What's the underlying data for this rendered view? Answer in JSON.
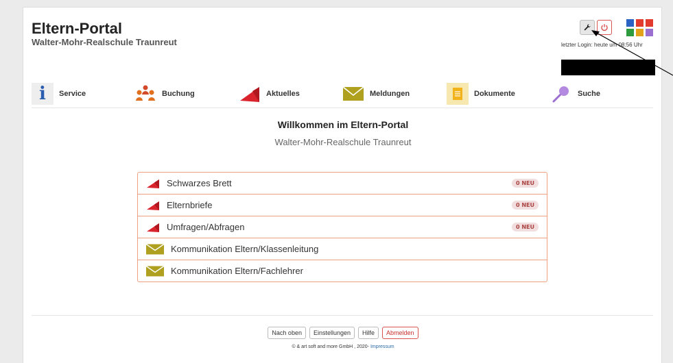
{
  "header": {
    "title": "Eltern-Portal",
    "subtitle": "Walter-Mohr-Realschule Traunreut",
    "last_login": "letzter Login: heute um 08:56 Uhr"
  },
  "toolbar": {
    "settings_icon": "wrench-icon",
    "logout_icon": "power-icon",
    "apps_icon": "tile-grid-icon",
    "tile_colors": [
      "#2a63c4",
      "#e23a2e",
      "#e23a2e",
      "#2e9c3e",
      "#e2a21a",
      "#9b6fcf"
    ]
  },
  "nav": [
    {
      "label": "Service",
      "icon": "info-icon"
    },
    {
      "label": "Buchung",
      "icon": "people-icon"
    },
    {
      "label": "Aktuelles",
      "icon": "megaphone-icon"
    },
    {
      "label": "Meldungen",
      "icon": "envelope-icon"
    },
    {
      "label": "Dokumente",
      "icon": "document-icon"
    },
    {
      "label": "Suche",
      "icon": "magnifier-icon"
    }
  ],
  "welcome": {
    "title": "Willkommen im Eltern-Portal",
    "subtitle": "Walter-Mohr-Realschule Traunreut"
  },
  "list": [
    {
      "label": "Schwarzes Brett",
      "icon": "megaphone-icon",
      "badge": "0 NEU"
    },
    {
      "label": "Elternbriefe",
      "icon": "megaphone-icon",
      "badge": "0 NEU"
    },
    {
      "label": "Umfragen/Abfragen",
      "icon": "megaphone-icon",
      "badge": "0 NEU"
    },
    {
      "label": "Kommunikation Eltern/Klassenleitung",
      "icon": "envelope-icon"
    },
    {
      "label": "Kommunikation Eltern/Fachlehrer",
      "icon": "envelope-icon"
    }
  ],
  "footer": {
    "buttons": [
      "Nach oben",
      "Einstellungen",
      "Hilfe",
      "Abmelden"
    ],
    "copyright": "© & art soft and more GmbH , 2020-",
    "impressum": "Impressum"
  },
  "colors": {
    "accent_red": "#c9302c",
    "list_border": "#f0a080",
    "megaphone": "#d9232d",
    "envelope": "#b0a020"
  }
}
